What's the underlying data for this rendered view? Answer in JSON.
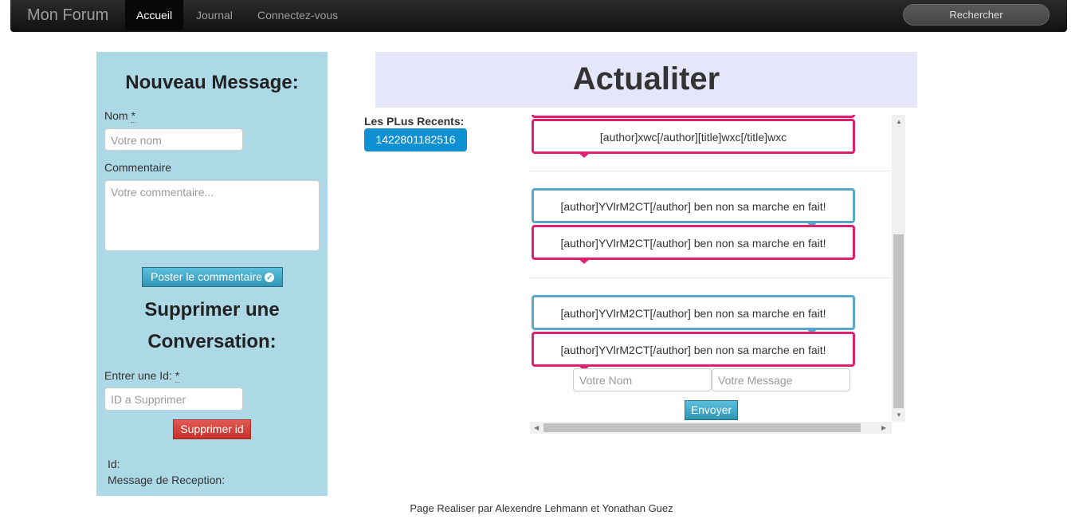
{
  "navbar": {
    "brand": "Mon Forum",
    "items": [
      {
        "label": "Accueil",
        "active": true
      },
      {
        "label": "Journal",
        "active": false
      },
      {
        "label": "Connectez-vous",
        "active": false
      }
    ],
    "search_label": "Rechercher"
  },
  "new_message": {
    "title": "Nouveau Message:",
    "name_label": "Nom",
    "name_placeholder": "Votre nom",
    "comment_label": "Commentaire",
    "comment_placeholder": "Votre commentaire...",
    "post_button": "Poster le commentaire"
  },
  "delete": {
    "title_line1": "Supprimer une",
    "title_line2": "Conversation:",
    "id_label": "Entrer une Id:",
    "id_placeholder": "ID a Supprimer",
    "delete_button": "Supprimer id",
    "id_text": "Id:",
    "reception_text": "Message de Reception:"
  },
  "main": {
    "title": "Actualiter",
    "recent_label": "Les PLus Recents:",
    "recent_button": "1422801182516"
  },
  "chat": {
    "messages": [
      {
        "text": "[author]xwc[/author][title]wxc[/title]wxc",
        "style": "pink"
      },
      {
        "text": "[author]YVlrM2CT[/author] ben non sa marche en fait!",
        "style": "blue"
      },
      {
        "text": "[author]YVlrM2CT[/author] ben non sa marche en fait!",
        "style": "pink"
      },
      {
        "text": "[author]YVlrM2CT[/author] ben non sa marche en fait!",
        "style": "blue"
      },
      {
        "text": "[author]YVlrM2CT[/author] ben non sa marche en fait!",
        "style": "pink"
      }
    ],
    "name_placeholder": "Votre Nom",
    "message_placeholder": "Votre Message",
    "send_button": "Envoyer"
  },
  "footer": "Page Realiser par Alexendre Lehmann et Yonathan Guez",
  "colors": {
    "panel": "#add8e6",
    "header": "#e6e6fa",
    "pink": "#e0206e",
    "blue": "#5aa6c8"
  }
}
